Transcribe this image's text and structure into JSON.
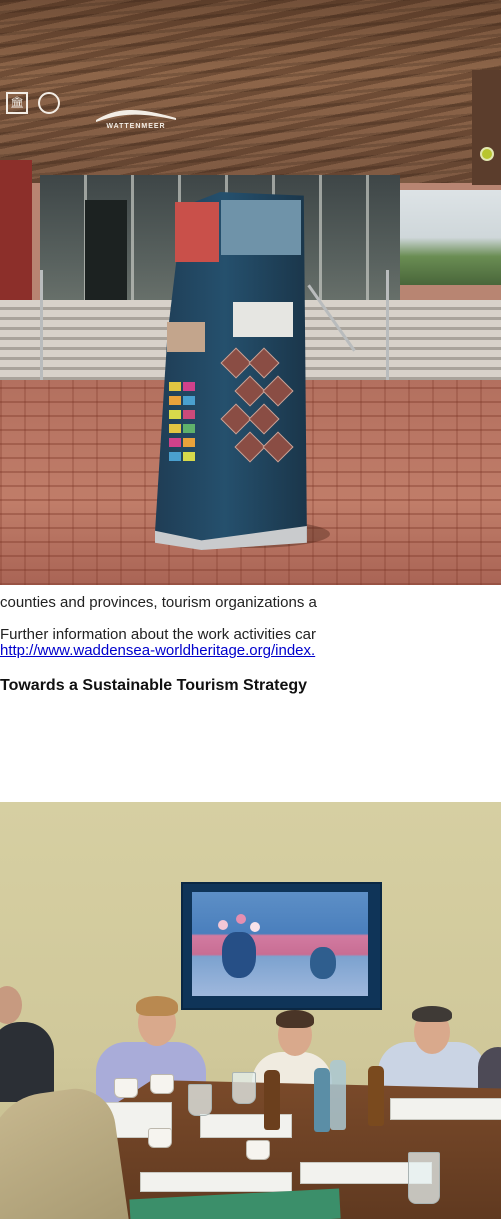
{
  "photo_top": {
    "logos": {
      "unesco_glyph": "🏛",
      "brand_text": "WATTENMEER"
    }
  },
  "text": {
    "line1": "counties and provinces, tourism organizations a",
    "line2": "Further information about the work activities car",
    "link": "http://www.waddensea-worldheritage.org/index.",
    "heading": "Towards a Sustainable Tourism Strategy"
  },
  "colors": {
    "link": "#0000cc",
    "body_text": "#222222"
  }
}
